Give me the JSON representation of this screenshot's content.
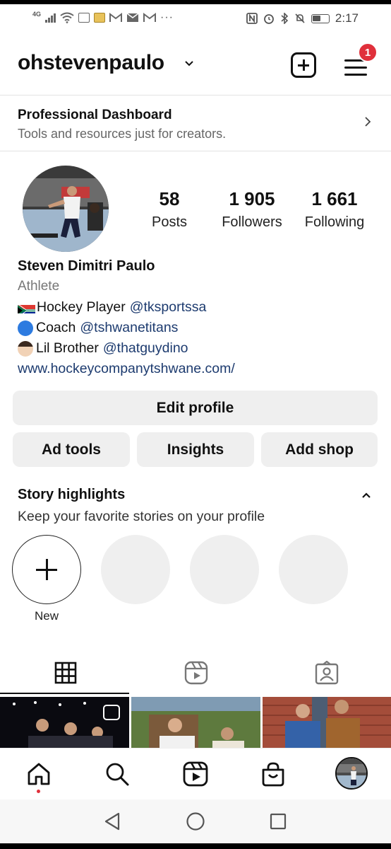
{
  "status_bar": {
    "network": "4G",
    "time": "2:17"
  },
  "header": {
    "username": "ohstevenpaulo",
    "notification_count": "1"
  },
  "dashboard": {
    "title": "Professional Dashboard",
    "subtitle": "Tools and resources just for creators."
  },
  "profile": {
    "stats": [
      {
        "value": "58",
        "label": "Posts"
      },
      {
        "value": "1 905",
        "label": "Followers"
      },
      {
        "value": "1 661",
        "label": "Following"
      }
    ],
    "name": "Steven Dimitri Paulo",
    "category": "Athlete",
    "bio_lines": [
      {
        "text": "Hockey Player",
        "mention": "@tksportssa"
      },
      {
        "text": "Coach",
        "mention": "@tshwanetitans"
      },
      {
        "text": "Lil Brother",
        "mention": "@thatguydino"
      }
    ],
    "link": "www.hockeycompanytshwane.com/"
  },
  "buttons": {
    "edit_profile": "Edit profile",
    "ad_tools": "Ad tools",
    "insights": "Insights",
    "add_shop": "Add shop"
  },
  "highlights": {
    "title": "Story highlights",
    "subtitle": "Keep your favorite stories on your profile",
    "new_label": "New"
  },
  "tabs": [
    "grid-icon",
    "reels-icon",
    "tagged-icon"
  ],
  "nav": [
    "home-icon",
    "search-icon",
    "reels-icon",
    "shop-icon",
    "profile-avatar"
  ],
  "colors": {
    "accent_link": "#1d3b6f",
    "badge": "#e0303b",
    "button_bg": "#efefef"
  }
}
